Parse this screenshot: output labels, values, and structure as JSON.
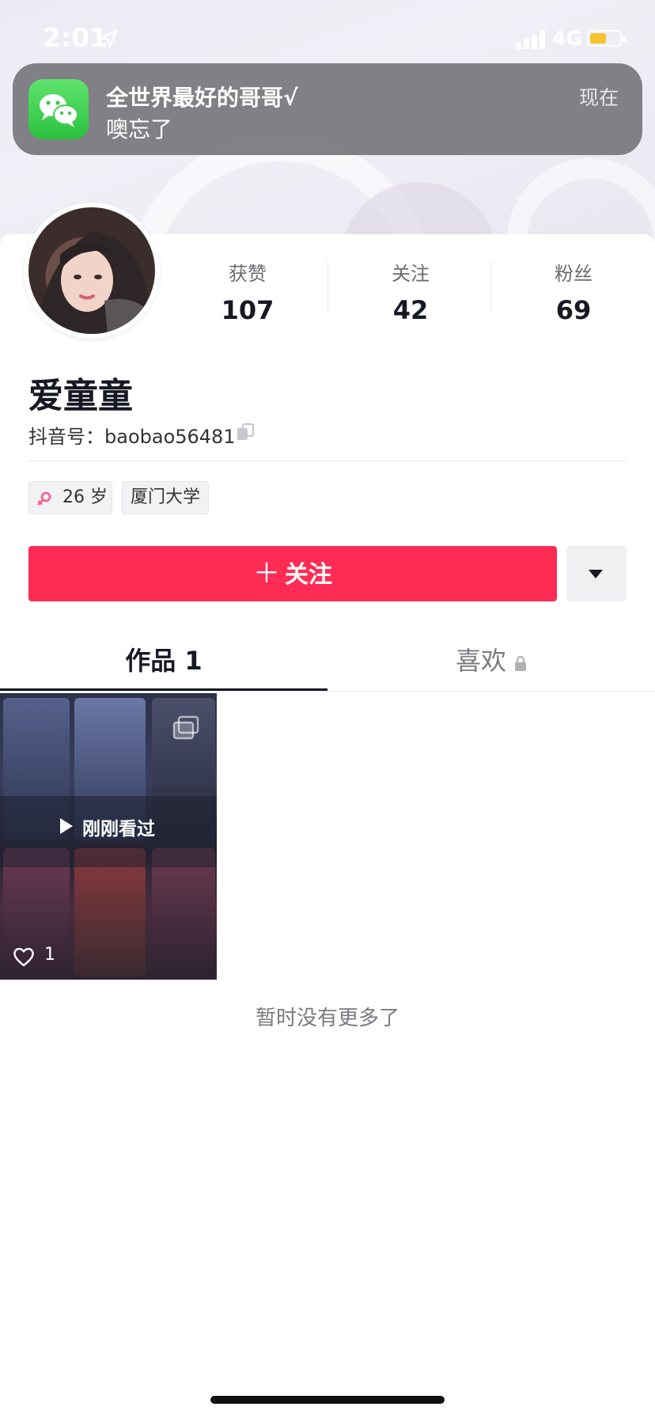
{
  "status_bar": {
    "time": "2:01",
    "network": "4G",
    "battery_level": 0.55,
    "battery_color": "#f5c42c"
  },
  "notification": {
    "app": "wechat-icon",
    "title": "全世界最好的哥哥√",
    "message": "噢忘了",
    "time": "现在"
  },
  "profile": {
    "stats": [
      {
        "label": "获赞",
        "value": "107"
      },
      {
        "label": "关注",
        "value": "42"
      },
      {
        "label": "粉丝",
        "value": "69"
      }
    ],
    "name": "爱童童",
    "handle": "抖音号：baobao56481",
    "tags": {
      "age": "26 岁",
      "school": "厦门大学"
    },
    "follow_label": "关注"
  },
  "tabs": {
    "works": "作品 1",
    "likes": "喜欢"
  },
  "video": {
    "overlay": "刚刚看过",
    "likes": "1"
  },
  "footer": {
    "end_text": "暂时没有更多了"
  },
  "colors": {
    "accent": "#fe2c55",
    "text": "#161823"
  }
}
